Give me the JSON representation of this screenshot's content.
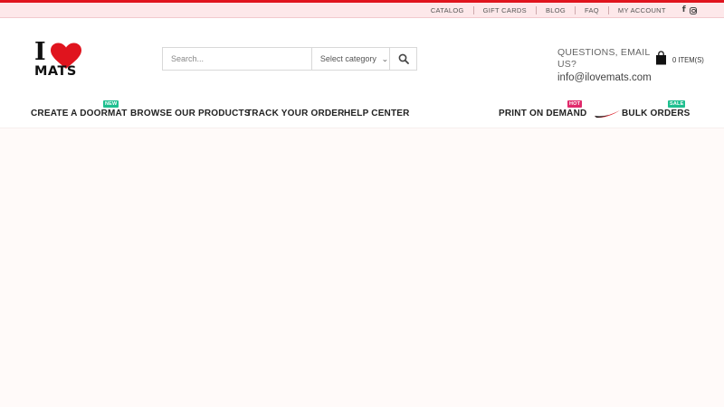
{
  "topbar": {
    "links": [
      "CATALOG",
      "GIFT CARDS",
      "BLOG",
      "FAQ",
      "MY ACCOUNT"
    ],
    "social_icons": [
      "facebook-icon",
      "instagram-icon"
    ],
    "facebook_glyph": "f"
  },
  "logo": {
    "line1": "I",
    "line2": "MATS"
  },
  "search": {
    "placeholder": "Search...",
    "category_label": "Select category",
    "button_icon": "search-icon"
  },
  "contact": {
    "question": "QUESTIONS, EMAIL US?",
    "email": "info@ilovemats.com"
  },
  "cart": {
    "count_label": "0 ITEM(S)",
    "icon": "shopping-bag-icon"
  },
  "nav": {
    "create_doormat": {
      "label": "CREATE A DOORMAT",
      "badge": "NEW"
    },
    "browse_products": {
      "label": "BROWSE OUR PRODUCTS"
    },
    "track_order": {
      "label": "TRACK YOUR ORDER"
    },
    "help_center": {
      "label": "HELP CENTER"
    },
    "print_on_demand": {
      "label": "PRINT ON DEMAND",
      "badge": "HOT"
    },
    "bulk_orders": {
      "label": "BULK ORDERS",
      "badge": "SALE"
    }
  },
  "colors": {
    "accent_red": "#e0141e",
    "topbar_bg": "#fde8ea",
    "badge_new": "#1fbf8f",
    "badge_hot": "#e02a6b",
    "badge_sale": "#1fbf8f"
  }
}
